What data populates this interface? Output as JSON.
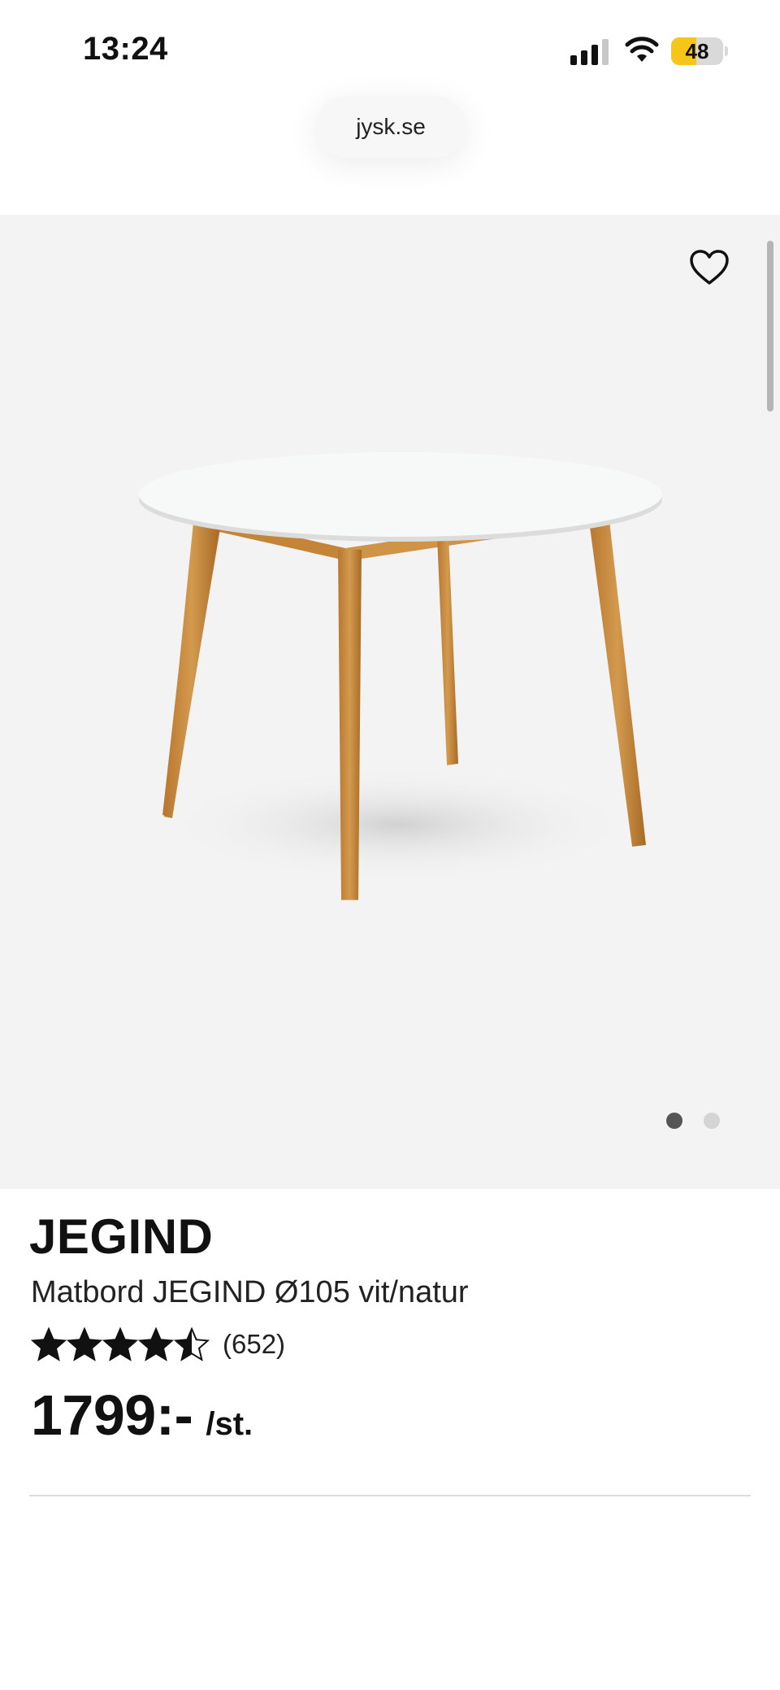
{
  "status_bar": {
    "time": "13:24",
    "battery_level": "48",
    "battery_fraction": 0.48,
    "battery_color": "#f5c518"
  },
  "browser": {
    "url": "jysk.se"
  },
  "gallery": {
    "favorite_icon": "heart-outline-icon",
    "image_alt_subject": "round dining table",
    "image_count": 2,
    "active_index": 0
  },
  "product": {
    "brand": "JEGIND",
    "subtitle": "Matbord JEGIND Ø105 vit/natur",
    "rating": 4.5,
    "rating_max": 5,
    "reviews": "(652)",
    "price": "1799:-",
    "unit": "/st."
  },
  "colors": {
    "gallery_bg": "#f3f3f3",
    "wood": "#c98b3e",
    "tabletop": "#f7f8f8",
    "dot_active": "#555555",
    "dot_inactive": "#d4d4d4"
  }
}
